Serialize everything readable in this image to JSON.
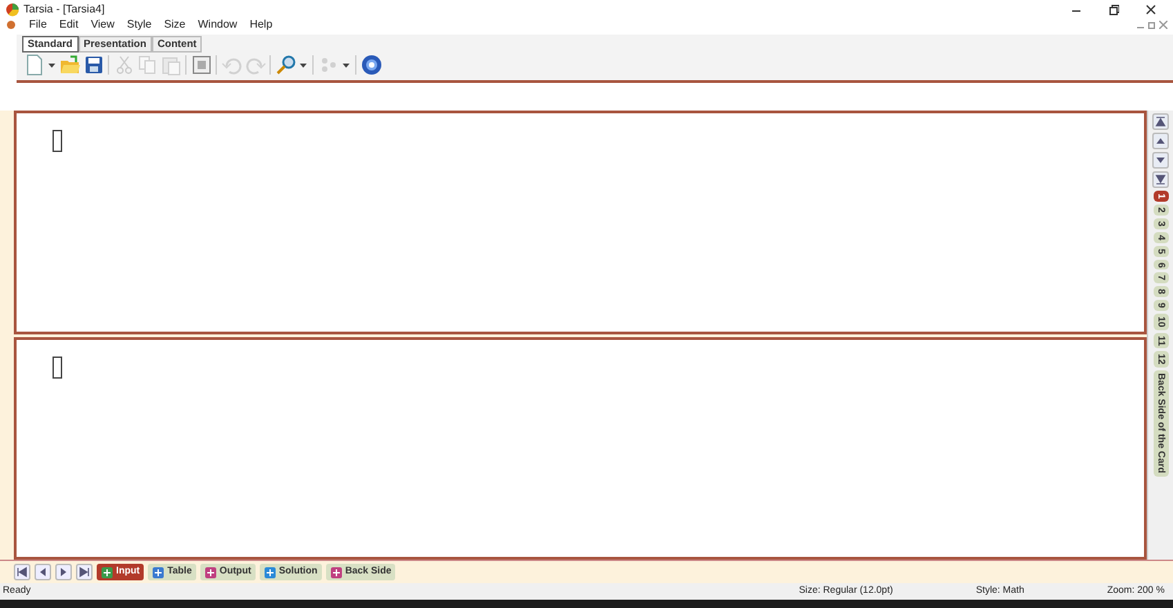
{
  "window": {
    "title": "Tarsia - [Tarsia4]"
  },
  "menu": [
    "File",
    "Edit",
    "View",
    "Style",
    "Size",
    "Window",
    "Help"
  ],
  "toolbar_tabs": [
    {
      "label": "Standard",
      "selected": true
    },
    {
      "label": "Presentation",
      "selected": false
    },
    {
      "label": "Content",
      "selected": false
    }
  ],
  "toolbar": [
    {
      "kind": "new",
      "disabled": false
    },
    {
      "kind": "caret",
      "disabled": false
    },
    {
      "kind": "open",
      "disabled": false
    },
    {
      "kind": "save",
      "disabled": false
    },
    {
      "kind": "sep"
    },
    {
      "kind": "cut",
      "disabled": true
    },
    {
      "kind": "copy",
      "disabled": true
    },
    {
      "kind": "paste",
      "disabled": true
    },
    {
      "kind": "sep"
    },
    {
      "kind": "frame",
      "disabled": false
    },
    {
      "kind": "sep"
    },
    {
      "kind": "undo",
      "disabled": true
    },
    {
      "kind": "redo",
      "disabled": true
    },
    {
      "kind": "sep"
    },
    {
      "kind": "zoom",
      "disabled": false
    },
    {
      "kind": "caret",
      "disabled": false
    },
    {
      "kind": "sep"
    },
    {
      "kind": "shape",
      "disabled": true
    },
    {
      "kind": "caret",
      "disabled": false
    },
    {
      "kind": "sep"
    },
    {
      "kind": "help",
      "disabled": false
    }
  ],
  "cards": [
    {
      "kind": "card"
    },
    {
      "kind": "card"
    }
  ],
  "side_tabs": [
    {
      "label": "1",
      "selected": true
    },
    {
      "label": "2",
      "selected": false
    },
    {
      "label": "3",
      "selected": false
    },
    {
      "label": "4",
      "selected": false
    },
    {
      "label": "5",
      "selected": false
    },
    {
      "label": "6",
      "selected": false
    },
    {
      "label": "7",
      "selected": false
    },
    {
      "label": "8",
      "selected": false
    },
    {
      "label": "9",
      "selected": false
    },
    {
      "label": "10",
      "selected": false
    },
    {
      "label": "11",
      "selected": false
    },
    {
      "label": "12",
      "selected": false
    },
    {
      "label": "Back Side of the Card",
      "selected": false
    }
  ],
  "bottom_tabs": [
    {
      "label": "Input",
      "selected": true,
      "color": "#3a9a4a"
    },
    {
      "label": "Table",
      "selected": false,
      "color": "#3a7ad0"
    },
    {
      "label": "Output",
      "selected": false,
      "color": "#c04080"
    },
    {
      "label": "Solution",
      "selected": false,
      "color": "#2a8ad8"
    },
    {
      "label": "Back Side",
      "selected": false,
      "color": "#c04080"
    }
  ],
  "status_bar": {
    "message": "Ready",
    "size": "Size: Regular (12.0pt)",
    "style": "Style: Math",
    "zoom": "Zoom: 200 %"
  }
}
